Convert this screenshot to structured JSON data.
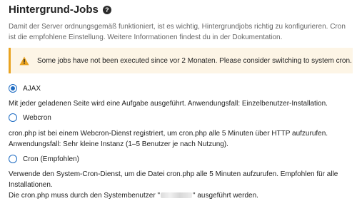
{
  "section": {
    "title": "Hintergrund-Jobs",
    "help_icon": "help-circle-icon",
    "description": "Damit der Server ordnungsgemäß funktioniert, ist es wichtig, Hintergrundjobs richtig zu konfigurieren. Cron ist die empfohlene Einstellung. Weitere Informationen findest du in der Dokumentation."
  },
  "warning": {
    "icon": "warning-triangle-icon",
    "text": "Some jobs have not been executed since vor 2 Monaten. Please consider switching to system cron.",
    "accent_color": "#e9a321"
  },
  "options": [
    {
      "label": "AJAX",
      "checked": true,
      "description": "Mit jeder geladenen Seite wird eine Aufgabe ausgeführt. Anwendungsfall: Einzelbenutzer-Installation."
    },
    {
      "label": "Webcron",
      "checked": false,
      "description": "cron.php ist bei einem Webcron-Dienst registriert, um cron.php alle 5 Minuten über HTTP aufzurufen. Anwendungsfall: Sehr kleine Instanz (1–5 Benutzer je nach Nutzung)."
    },
    {
      "label": "Cron (Empfohlen)",
      "checked": false,
      "description_line1": "Verwende den System-Cron-Dienst, um die Datei cron.php alle 5 Minuten aufzurufen. Empfohlen für alle Installationen.",
      "description_line2_before": "Die cron.php muss durch den Systembenutzer \"",
      "description_line2_after": "\" ausgeführt werden."
    }
  ],
  "accent_color": "#1d6bc2"
}
